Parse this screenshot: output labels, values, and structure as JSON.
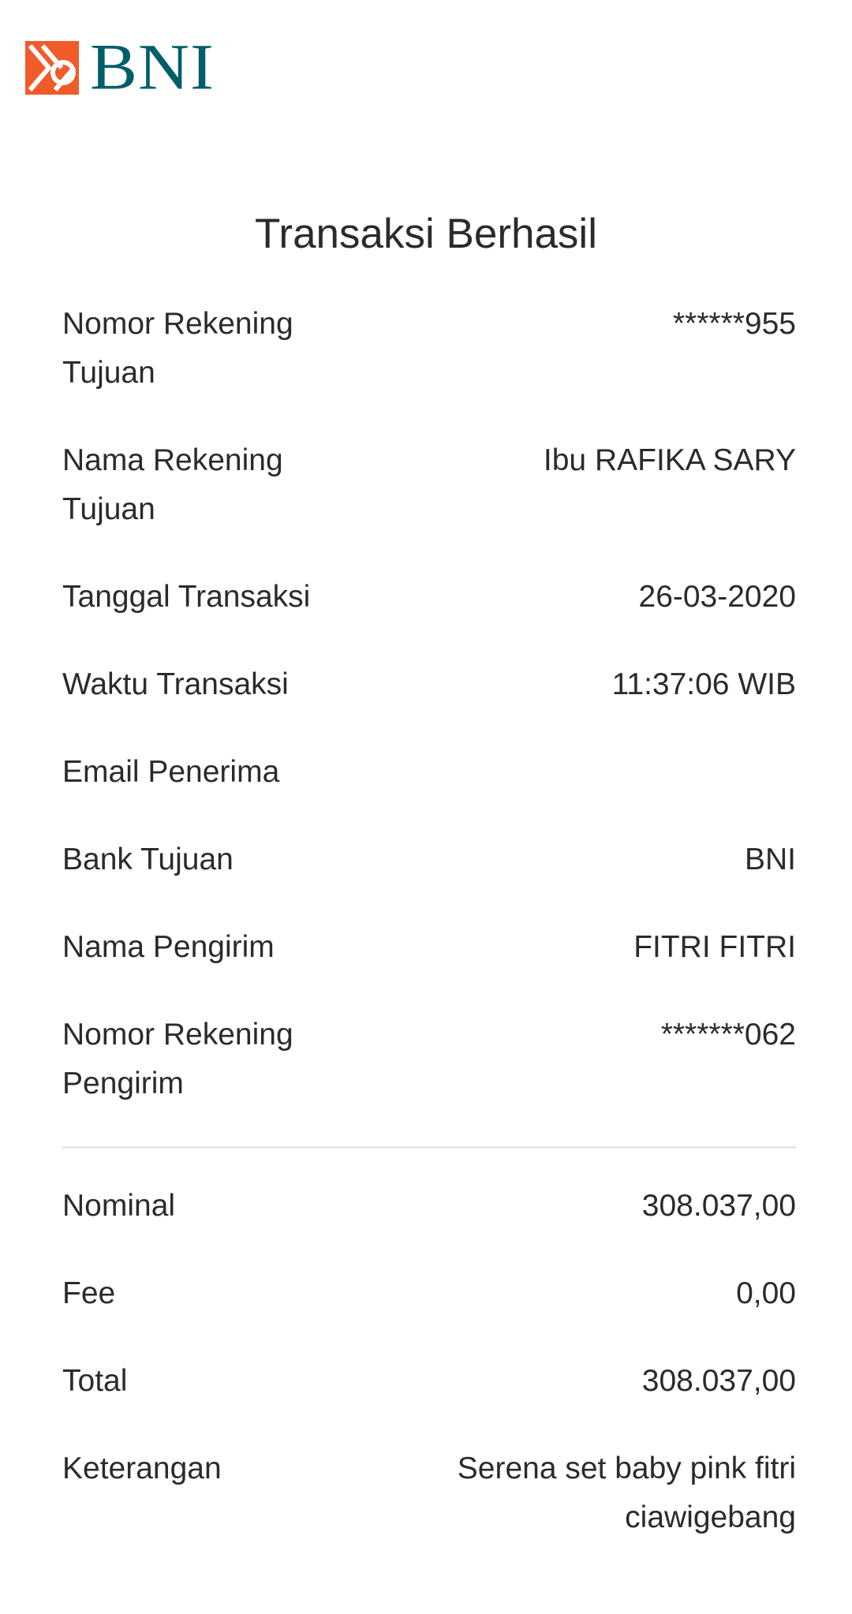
{
  "header": {
    "brand_text": "BNI",
    "logo_icon": "bni-logo-icon",
    "brand_color": "#005e6a",
    "accent_color": "#f15a29"
  },
  "page": {
    "title": "Transaksi Berhasil"
  },
  "details": {
    "rekening_tujuan_label": "Nomor Rekening Tujuan",
    "rekening_tujuan_value": "******955",
    "nama_tujuan_label": "Nama Rekening Tujuan",
    "nama_tujuan_value": "Ibu RAFIKA SARY",
    "tanggal_label": "Tanggal Transaksi",
    "tanggal_value": "26-03-2020",
    "waktu_label": "Waktu Transaksi",
    "waktu_value": "11:37:06 WIB",
    "email_label": "Email Penerima",
    "email_value": "",
    "bank_label": "Bank Tujuan",
    "bank_value": "BNI",
    "pengirim_label": "Nama Pengirim",
    "pengirim_value": "FITRI FITRI",
    "rekening_pengirim_label": "Nomor Rekening Pengirim",
    "rekening_pengirim_value": "*******062"
  },
  "amounts": {
    "nominal_label": "Nominal",
    "nominal_value": "308.037,00",
    "fee_label": "Fee",
    "fee_value": "0,00",
    "total_label": "Total",
    "total_value": "308.037,00",
    "keterangan_label": "Keterangan",
    "keterangan_value": "Serena set baby pink fitri ciawigebang"
  }
}
